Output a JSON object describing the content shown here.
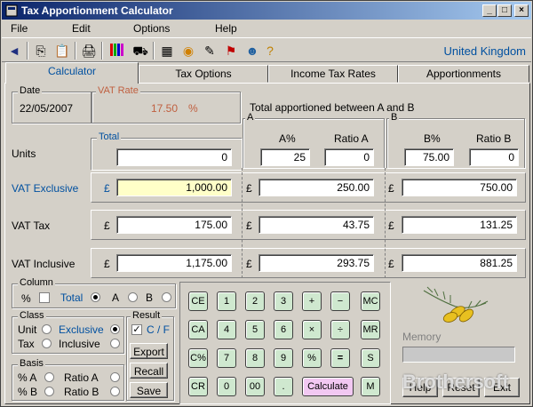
{
  "window": {
    "title": "Tax Apportionment Calculator"
  },
  "menu": [
    "File",
    "Edit",
    "Options",
    "Help"
  ],
  "toolbar": {
    "country": "United Kingdom"
  },
  "tabs": [
    "Calculator",
    "Tax Options",
    "Income Tax Rates",
    "Apportionments"
  ],
  "date_group": {
    "label": "Date",
    "value": "22/05/2007"
  },
  "vat_rate_group": {
    "label": "VAT Rate",
    "value": "17.50",
    "unit": "%"
  },
  "apportion": {
    "title": "Total apportioned between A and B",
    "a_label": "A",
    "b_label": "B",
    "a_pct_label": "A%",
    "ratio_a_label": "Ratio A",
    "b_pct_label": "B%",
    "ratio_b_label": "Ratio B"
  },
  "rows": {
    "units": {
      "label": "Units",
      "total_label": "Total",
      "total": "0",
      "a_pct": "25",
      "ratio_a": "0",
      "b_pct": "75.00",
      "ratio_b": "0"
    },
    "vat_exclusive": {
      "label": "VAT Exclusive",
      "total": "1,000.00",
      "a": "250.00",
      "b": "750.00"
    },
    "vat_tax": {
      "label": "VAT Tax",
      "total": "175.00",
      "a": "43.75",
      "b": "131.25"
    },
    "vat_inclusive": {
      "label": "VAT Inclusive",
      "total": "1,175.00",
      "a": "293.75",
      "b": "881.25"
    }
  },
  "currency": "£",
  "column_group": {
    "label": "Column",
    "pct": "%",
    "total": "Total",
    "a": "A",
    "b": "B"
  },
  "class_group": {
    "label": "Class",
    "unit": "Unit",
    "exclusive": "Exclusive",
    "tax": "Tax",
    "inclusive": "Inclusive"
  },
  "basis_group": {
    "label": "Basis",
    "pct_a": "% A",
    "ratio_a": "Ratio A",
    "pct_b": "% B",
    "ratio_b": "Ratio B"
  },
  "result_group": {
    "label": "Result",
    "cf": "C / F",
    "export": "Export",
    "recall": "Recall",
    "save": "Save"
  },
  "calculator": {
    "row1": [
      "CE",
      "1",
      "2",
      "3",
      "+",
      "−",
      "MC"
    ],
    "row2": [
      "CA",
      "4",
      "5",
      "6",
      "×",
      "÷",
      "MR"
    ],
    "row3": [
      "C%",
      "7",
      "8",
      "9",
      "%",
      "=",
      "S"
    ],
    "row4": [
      "CR",
      "0",
      "00",
      "."
    ],
    "calculate": "Calculate",
    "m": "M"
  },
  "memory": {
    "label": "Memory"
  },
  "bottom_buttons": {
    "help": "Help",
    "reset": "Reset",
    "exit": "Exit"
  },
  "watermark": "Brothersoft"
}
